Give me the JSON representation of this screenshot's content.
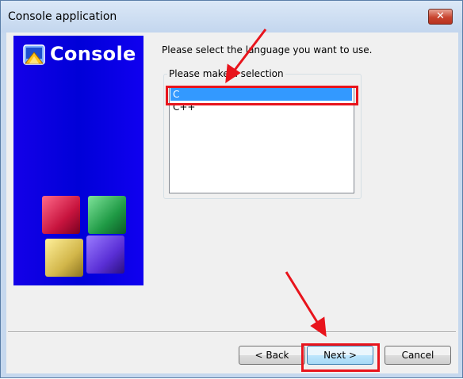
{
  "window": {
    "title": "Console application",
    "close_symbol": "✕"
  },
  "sidebar": {
    "title": "Console"
  },
  "main": {
    "prompt": "Please select the language you want to use.",
    "group_label": "Please make a selection",
    "languages": [
      {
        "label": "C",
        "selected": true
      },
      {
        "label": "C++",
        "selected": false
      }
    ]
  },
  "buttons": {
    "back": "< Back",
    "next": "Next >",
    "cancel": "Cancel"
  },
  "colors": {
    "sidebar_blue": "#0000e0",
    "selection": "#3399ff",
    "annotation_red": "#e8141c"
  }
}
